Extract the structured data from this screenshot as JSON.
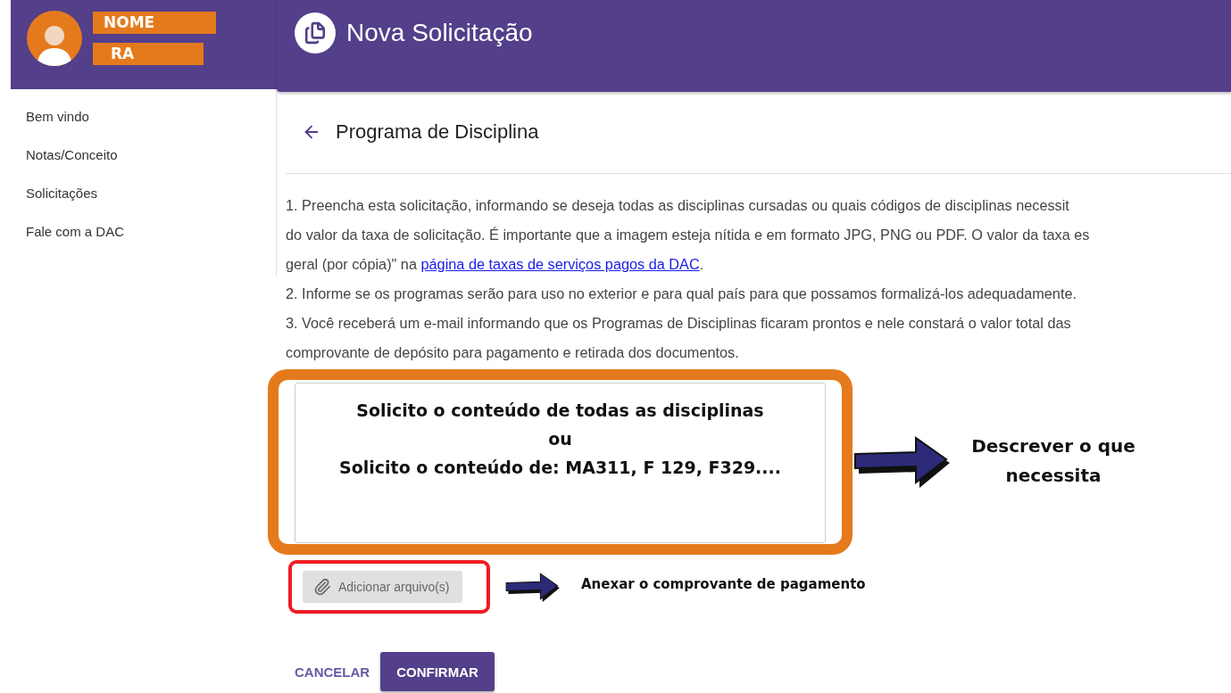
{
  "sidebar": {
    "profile": {
      "name_label": "NOME",
      "id_label": "RA"
    },
    "items": [
      {
        "label": "Bem vindo"
      },
      {
        "label": "Notas/Conceito"
      },
      {
        "label": "Solicitações"
      },
      {
        "label": "Fale com a DAC"
      }
    ]
  },
  "header": {
    "title": "Nova Solicitação"
  },
  "page": {
    "title": "Programa de Disciplina"
  },
  "instructions": [
    {
      "kind": "text",
      "text": "1. Preencha esta solicitação, informando se deseja todas as disciplinas cursadas ou quais códigos de disciplinas necessit"
    },
    {
      "kind": "text",
      "text": "do valor da taxa de solicitação. É importante que a imagem esteja nítida e em formato JPG, PNG ou PDF. O valor da taxa es"
    },
    {
      "kind": "link",
      "before": "geral (por cópia)\" na ",
      "link": "página de taxas de serviços pagos da DAC",
      "after": "."
    },
    {
      "kind": "text",
      "text": "2. Informe se os programas serão para uso no exterior e para qual país para que possamos formalizá-los adequadamente."
    },
    {
      "kind": "text",
      "text": "3. Você receberá um e-mail informando que os Programas de Disciplinas ficaram prontos e nele constará o valor total das"
    },
    {
      "kind": "text",
      "text": "comprovante de depósito para pagamento e retirada dos documentos."
    }
  ],
  "request_field": {
    "lines": [
      "Solicito o conteúdo de todas as disciplinas",
      "ou",
      "Solicito o conteúdo de: MA311, F 129, F329...."
    ]
  },
  "attach_button": {
    "label": "Adicionar arquivo(s)"
  },
  "annotations": [
    {
      "kind": "large",
      "text": "Descrever o que necessita"
    },
    {
      "kind": "small",
      "text": "Anexar o comprovante de pagamento"
    }
  ],
  "actions": [
    {
      "kind": "text",
      "label": "CANCELAR"
    },
    {
      "kind": "contained",
      "label": "CONFIRMAR"
    }
  ]
}
